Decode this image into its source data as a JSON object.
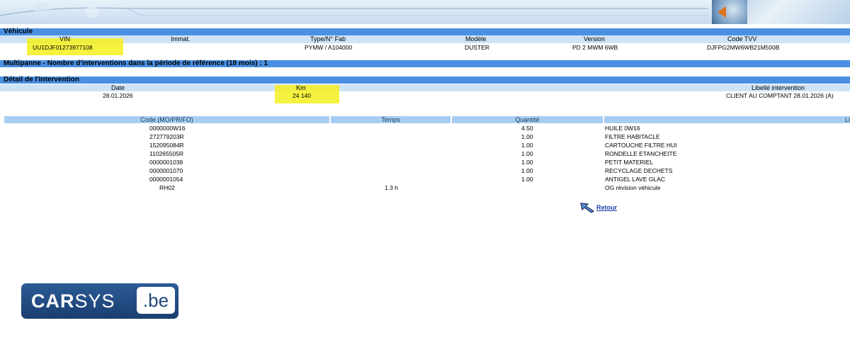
{
  "vehicle": {
    "section_title": "Véhicule",
    "headers": [
      "VIN",
      "Immat.",
      "Type/N° Fab",
      "Modèle",
      "Version",
      "Code TVV"
    ],
    "values": [
      "UU1DJF01273977108",
      "",
      "PYMW / A104000",
      "DUSTER",
      "PD 2 MWM 6WB",
      "DJFPG2MW6WB21M500B"
    ]
  },
  "multipanne": {
    "text": "Multipanne - Nombre d'interventions dans la période de référence (18 mois) : 1"
  },
  "intervention": {
    "section_title": "Détail de l'intervention",
    "headers": {
      "date": "Date",
      "km": "Km",
      "libelle": "Libellé intervention"
    },
    "values": {
      "date": "28.01.2026",
      "km": "24 140",
      "libelle": "CLIENT AU COMPTANT 28.01.2026 (A)"
    }
  },
  "parts": {
    "headers": [
      "Code (MO/PR/FO)",
      "Temps",
      "Quantité",
      "Li"
    ],
    "rows": [
      {
        "code": "0000000W16",
        "temps": "",
        "quantite": "4.50",
        "libelle": "HUILE 0W16"
      },
      {
        "code": "272779203R",
        "temps": "",
        "quantite": "1.00",
        "libelle": "FILTRE HABITACLE"
      },
      {
        "code": "152095084R",
        "temps": "",
        "quantite": "1.00",
        "libelle": "CARTOUCHE FILTRE HUI"
      },
      {
        "code": "110265505R",
        "temps": "",
        "quantite": "1.00",
        "libelle": "RONDELLE ETANCHEITE"
      },
      {
        "code": "0000001038",
        "temps": "",
        "quantite": "1.00",
        "libelle": "PETIT MATERIEL"
      },
      {
        "code": "0000001070",
        "temps": "",
        "quantite": "1.00",
        "libelle": "RECYCLAGE DECHETS"
      },
      {
        "code": "0000001054",
        "temps": "",
        "quantite": "1.00",
        "libelle": "ANTIGEL LAVE GLAC"
      },
      {
        "code": "RH02",
        "temps": "1.3 h",
        "quantite": "",
        "libelle": "OG révision véhicule"
      }
    ]
  },
  "retour": {
    "label": "Retour",
    "icon": "back-arrow-icon"
  },
  "logo": {
    "car": "CAR",
    "sys": "SYS",
    "be": ".be"
  },
  "colors": {
    "section_bar": "#4a90e2",
    "column_header": "#a7cdf2",
    "highlight": "#f4f01e",
    "logo_bg": "#1f4779"
  }
}
